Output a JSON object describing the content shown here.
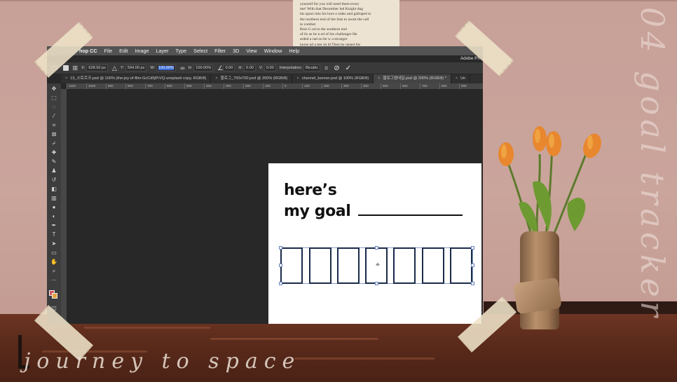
{
  "book_page": {
    "lines": [
      "yourself for you will need them every",
      "me!  With that      December led Knight dug",
      "his spurs into his hors  o sides and galloped to",
      "the northern end of the lists to await the call",
      "to combat",
      "Bros G              ed to the southern end",
      "of lis   as he    n ed   of his challenger He",
      "arded a   rad  ou be   w a stronger",
      "horse    nd a   tter sh ld  Then he raised his"
    ]
  },
  "menubar": {
    "app_name": "hop CC",
    "items": [
      "File",
      "Edit",
      "Image",
      "Layer",
      "Type",
      "Select",
      "Filter",
      "3D",
      "View",
      "Window",
      "Help"
    ],
    "right_text": "Adobe Ph"
  },
  "options_bar": {
    "x_label": "X:",
    "x_value": "628.50 px",
    "y_label": "Y:",
    "y_value": "594.00 px",
    "w_label": "W:",
    "w_value": "100.00%",
    "h_label": "H:",
    "h_value": "100.00%",
    "angle_value": "0.00",
    "hskew_label": "H:",
    "hskew_value": "0.00",
    "vskew_label": "V:",
    "vskew_value": "0.00",
    "interp_label": "Interpolation:",
    "interp_value": "Bicubic"
  },
  "tabs": [
    "13_스토르크.psd @ 100% (the-joy-of-film-GcCd5jPrVQ-unsplash copy, RGB/8)",
    "블로그_700x700.psd @ 200% (RGB/8)",
    "channel_banner.psd @ 100% (RGB/8)",
    "블로그썸네일.psd @ 200% (RGB/8) *",
    "Un"
  ],
  "ruler_ticks": [
    "1100",
    "1000",
    "900",
    "800",
    "700",
    "600",
    "500",
    "400",
    "300",
    "200",
    "100",
    "0",
    "100",
    "200",
    "300",
    "400",
    "500",
    "600",
    "700",
    "800",
    "900",
    "1000",
    "1100"
  ],
  "artboard": {
    "line1": "here’s",
    "line2": "my goal",
    "box_count": 7
  },
  "decor": {
    "vertical_script": "04 goal tracker",
    "bottom_script": "journey to space"
  },
  "colors": {
    "wall": "#c7a098",
    "table": "#5b2b1b",
    "accent_selection": "#3b6bd6",
    "tulip": "#e8872e"
  }
}
